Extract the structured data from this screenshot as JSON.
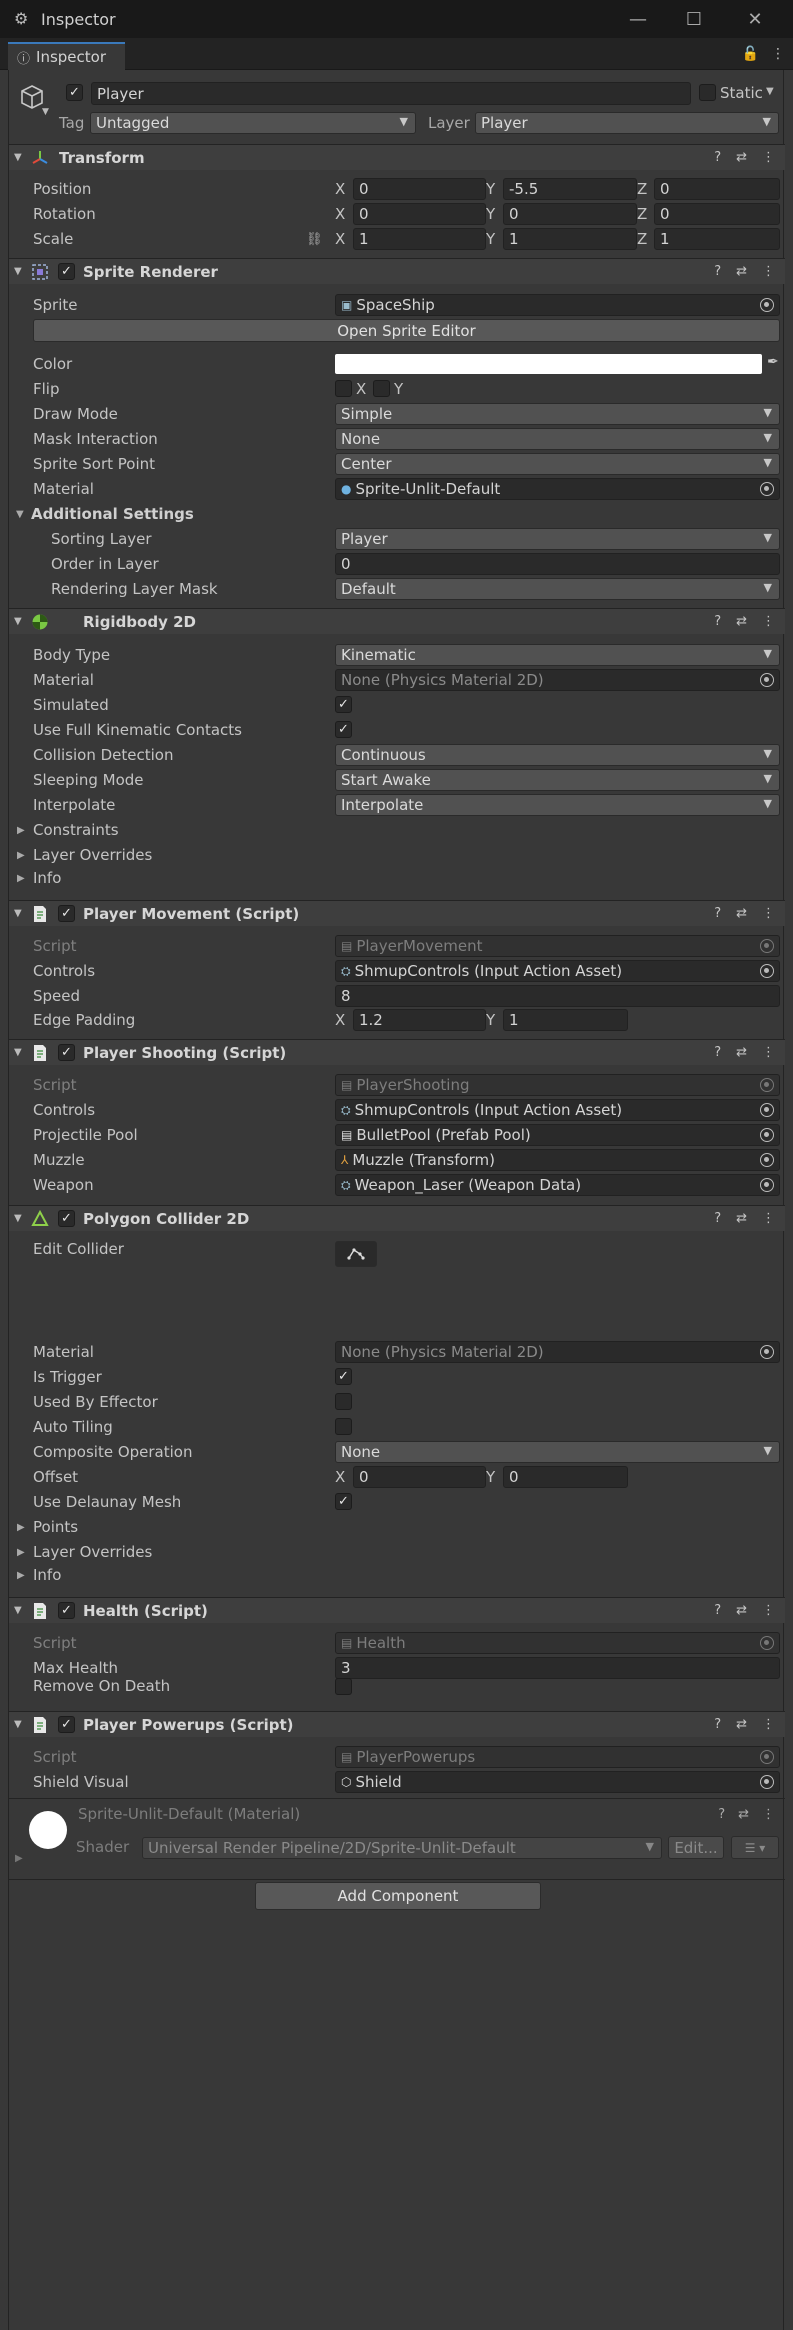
{
  "window": {
    "title": "Inspector",
    "minimize": "—",
    "maximize": "☐",
    "close": "✕"
  },
  "tab": {
    "label": "Inspector"
  },
  "gameobject": {
    "name": "Player",
    "static_label": "Static",
    "tag_label": "Tag",
    "tag_value": "Untagged",
    "layer_label": "Layer",
    "layer_value": "Player"
  },
  "transform": {
    "title": "Transform",
    "position_label": "Position",
    "position": {
      "x": "0",
      "y": "-5.5",
      "z": "0"
    },
    "rotation_label": "Rotation",
    "rotation": {
      "x": "0",
      "y": "0",
      "z": "0"
    },
    "scale_label": "Scale",
    "scale": {
      "x": "1",
      "y": "1",
      "z": "1"
    }
  },
  "axes": {
    "x": "X",
    "y": "Y",
    "z": "Z"
  },
  "sprite_renderer": {
    "title": "Sprite Renderer",
    "sprite_label": "Sprite",
    "sprite_value": "SpaceShip",
    "open_editor": "Open Sprite Editor",
    "color_label": "Color",
    "flip_label": "Flip",
    "flip_x": "X",
    "flip_y": "Y",
    "draw_mode_label": "Draw Mode",
    "draw_mode": "Simple",
    "mask_label": "Mask Interaction",
    "mask": "None",
    "sort_point_label": "Sprite Sort Point",
    "sort_point": "Center",
    "material_label": "Material",
    "material": "Sprite-Unlit-Default",
    "additional": "Additional Settings",
    "sorting_layer_label": "Sorting Layer",
    "sorting_layer": "Player",
    "order_label": "Order in Layer",
    "order": "0",
    "render_mask_label": "Rendering Layer Mask",
    "render_mask": "Default"
  },
  "rigidbody": {
    "title": "Rigidbody 2D",
    "body_type_label": "Body Type",
    "body_type": "Kinematic",
    "material_label": "Material",
    "material": "None (Physics Material 2D)",
    "simulated_label": "Simulated",
    "full_kinematic_label": "Use Full Kinematic Contacts",
    "collision_label": "Collision Detection",
    "collision": "Continuous",
    "sleeping_label": "Sleeping Mode",
    "sleeping": "Start Awake",
    "interpolate_label": "Interpolate",
    "interpolate": "Interpolate",
    "constraints": "Constraints",
    "layer_overrides": "Layer Overrides",
    "info": "Info"
  },
  "player_movement": {
    "title": "Player Movement (Script)",
    "script_label": "Script",
    "script": "PlayerMovement",
    "controls_label": "Controls",
    "controls": "ShmupControls (Input Action Asset)",
    "speed_label": "Speed",
    "speed": "8",
    "edge_label": "Edge Padding",
    "edge_x": "1.2",
    "edge_y": "1"
  },
  "player_shooting": {
    "title": "Player Shooting (Script)",
    "script_label": "Script",
    "script": "PlayerShooting",
    "controls_label": "Controls",
    "controls": "ShmupControls (Input Action Asset)",
    "pool_label": "Projectile Pool",
    "pool": "BulletPool (Prefab Pool)",
    "muzzle_label": "Muzzle",
    "muzzle": "Muzzle (Transform)",
    "weapon_label": "Weapon",
    "weapon": "Weapon_Laser (Weapon Data)"
  },
  "polygon_collider": {
    "title": "Polygon Collider 2D",
    "edit_label": "Edit Collider",
    "material_label": "Material",
    "material": "None (Physics Material 2D)",
    "trigger_label": "Is Trigger",
    "effector_label": "Used By Effector",
    "tiling_label": "Auto Tiling",
    "composite_label": "Composite Operation",
    "composite": "None",
    "offset_label": "Offset",
    "offset_x": "0",
    "offset_y": "0",
    "delaunay_label": "Use Delaunay Mesh",
    "points": "Points",
    "layer_overrides": "Layer Overrides",
    "info": "Info"
  },
  "health": {
    "title": "Health (Script)",
    "script_label": "Script",
    "script": "Health",
    "max_label": "Max Health",
    "max": "3",
    "remove_label": "Remove On Death"
  },
  "player_powerups": {
    "title": "Player Powerups (Script)",
    "script_label": "Script",
    "script": "PlayerPowerups",
    "shield_label": "Shield Visual",
    "shield": "Shield"
  },
  "material_preview": {
    "title": "Sprite-Unlit-Default (Material)",
    "shader_label": "Shader",
    "shader": "Universal Render Pipeline/2D/Sprite-Unlit-Default",
    "edit": "Edit..."
  },
  "add_component": "Add Component",
  "checkmark": "✓",
  "colors": {
    "accent": "#3a79bb",
    "background": "#383838",
    "header": "#3e3e3e",
    "field": "#2a2a2a"
  }
}
